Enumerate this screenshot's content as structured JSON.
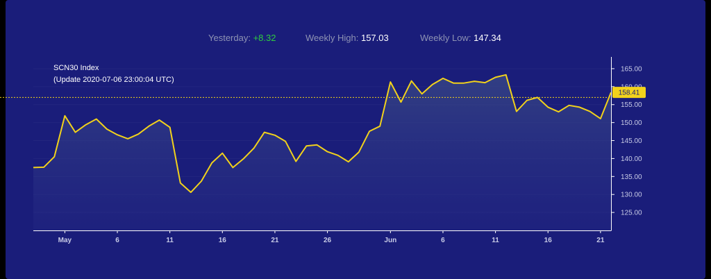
{
  "stats": {
    "yesterday_label": "Yesterday:",
    "yesterday_value": "+8.32",
    "weekly_high_label": "Weekly High:",
    "weekly_high_value": "157.03",
    "weekly_low_label": "Weekly Low:",
    "weekly_low_value": "147.34"
  },
  "chart_title": {
    "name": "SCN30 Index",
    "update": "(Update 2020-07-06 23:00:04 UTC)"
  },
  "current_price_label": "158.41",
  "colors": {
    "background": "#1a1d7a",
    "line": "#f2d21b",
    "up": "#2ecc40"
  },
  "chart_data": {
    "type": "area",
    "title": "SCN30 Index",
    "subtitle": "(Update 2020-07-06 23:00:04 UTC)",
    "x_axis": {
      "type": "date",
      "tick_labels": [
        "May",
        "6",
        "11",
        "16",
        "21",
        "26",
        "Jun",
        "6",
        "11",
        "16",
        "21"
      ]
    },
    "y_axis": {
      "position": "right",
      "ylim": [
        120,
        167.5
      ],
      "tick_labels": [
        "125.00",
        "130.00",
        "135.00",
        "140.00",
        "145.00",
        "150.00",
        "155.00",
        "160.00",
        "165.00"
      ]
    },
    "reference_line": {
      "value": 157.0,
      "style": "dotted"
    },
    "current_value": 158.41,
    "series": [
      {
        "x": [
          "2020-04-28",
          "2020-04-29",
          "2020-04-30",
          "2020-05-01",
          "2020-05-02",
          "2020-05-03",
          "2020-05-04",
          "2020-05-05",
          "2020-05-06",
          "2020-05-07",
          "2020-05-08",
          "2020-05-09",
          "2020-05-10",
          "2020-05-11",
          "2020-05-12",
          "2020-05-13",
          "2020-05-14",
          "2020-05-15",
          "2020-05-16",
          "2020-05-17",
          "2020-05-18",
          "2020-05-19",
          "2020-05-20",
          "2020-05-21",
          "2020-05-22",
          "2020-05-23",
          "2020-05-24",
          "2020-05-25",
          "2020-05-26",
          "2020-05-27",
          "2020-05-28",
          "2020-05-29",
          "2020-05-30",
          "2020-05-31",
          "2020-06-01",
          "2020-06-02",
          "2020-06-03",
          "2020-06-04",
          "2020-06-05",
          "2020-06-06",
          "2020-06-07",
          "2020-06-08",
          "2020-06-09",
          "2020-06-10",
          "2020-06-11",
          "2020-06-12",
          "2020-06-13",
          "2020-06-14",
          "2020-06-15",
          "2020-06-16",
          "2020-06-17",
          "2020-06-18",
          "2020-06-19",
          "2020-06-20",
          "2020-06-21",
          "2020-06-22"
        ],
        "values": [
          137.5,
          137.6,
          140.5,
          151.9,
          147.3,
          149.4,
          151.0,
          148.2,
          146.6,
          145.5,
          146.8,
          149.0,
          150.7,
          148.7,
          133.2,
          130.6,
          133.7,
          138.8,
          141.5,
          137.5,
          139.9,
          142.9,
          147.3,
          146.5,
          144.8,
          139.2,
          143.5,
          143.8,
          141.9,
          140.9,
          139.1,
          141.8,
          147.6,
          149.0,
          161.3,
          155.7,
          161.6,
          158.0,
          160.6,
          162.3,
          161.0,
          161.0,
          161.5,
          161.1,
          162.6,
          163.3,
          153.1,
          156.2,
          157.0,
          154.3,
          153.0,
          154.8,
          154.3,
          153.1,
          151.1,
          158.41
        ]
      }
    ]
  }
}
